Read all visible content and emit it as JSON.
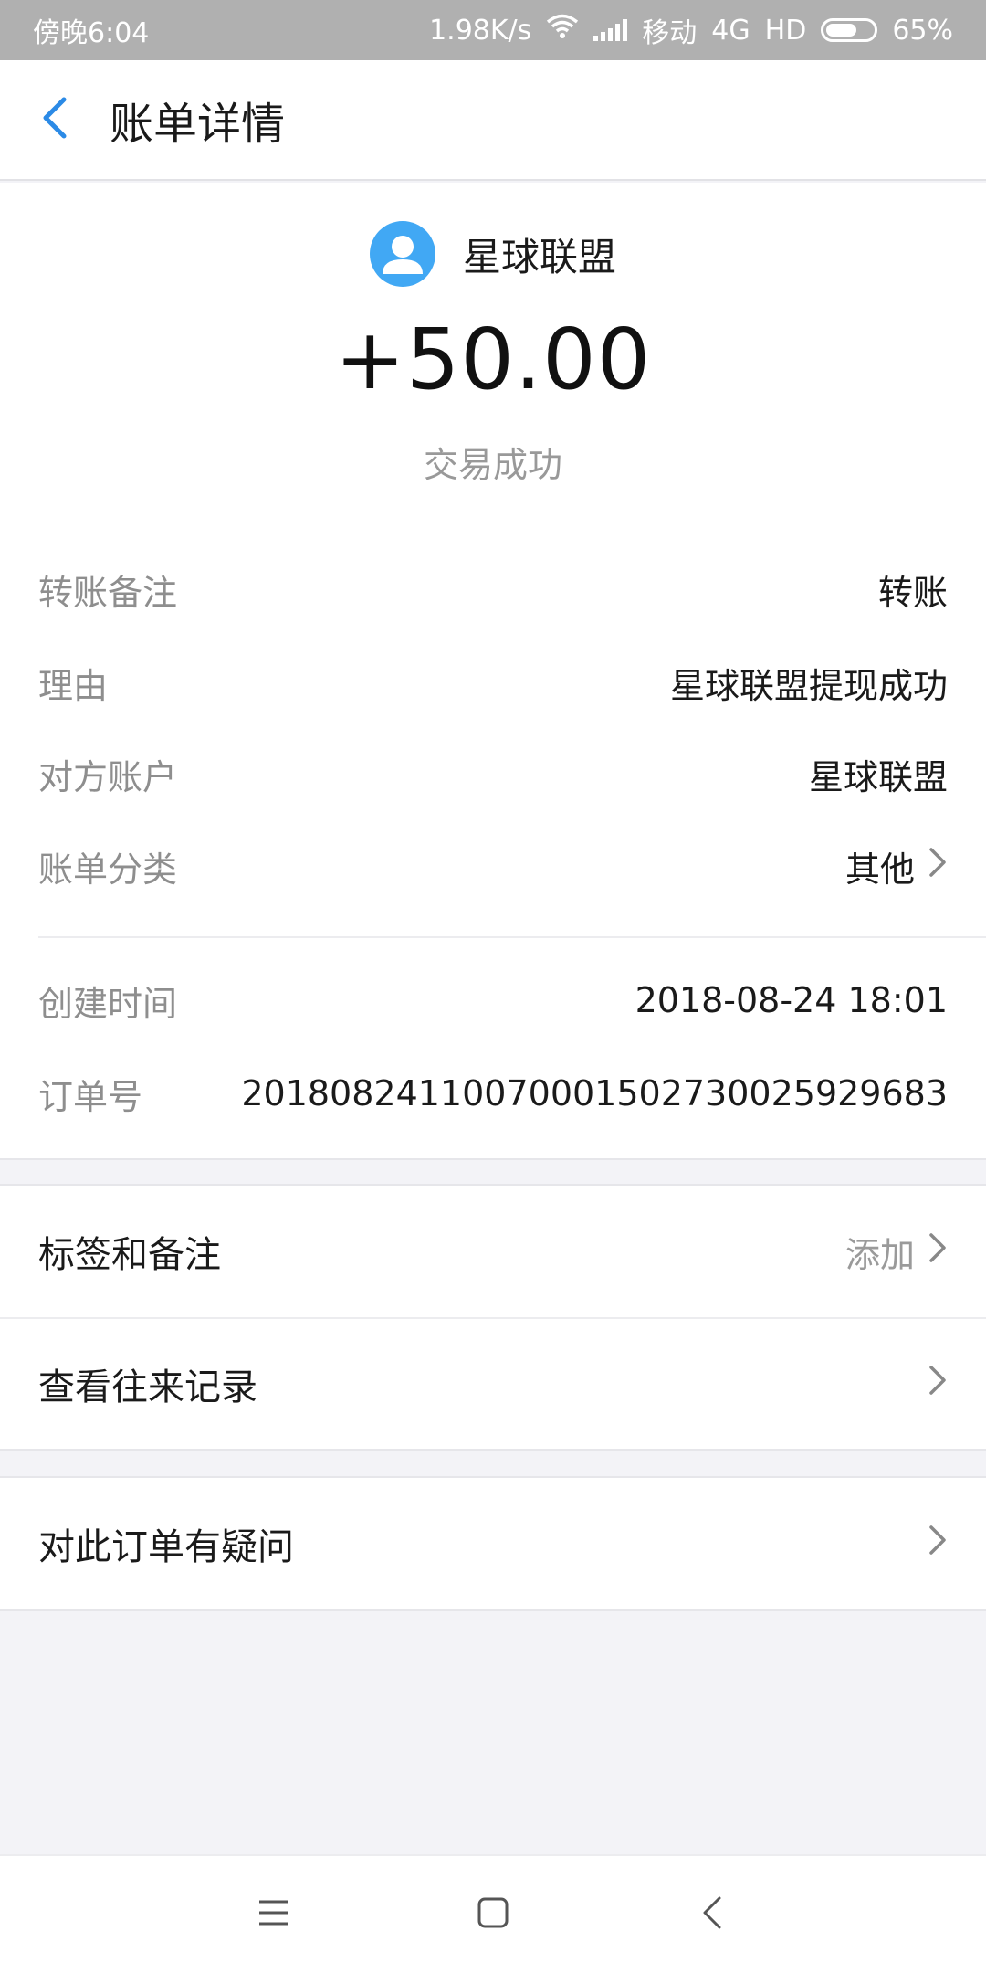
{
  "status_bar": {
    "time": "傍晚6:04",
    "speed": "1.98K/s",
    "carrier": "移动",
    "network": "4G",
    "hd": "HD",
    "battery_percent": "65%",
    "battery_level": 0.65
  },
  "header": {
    "title": "账单详情"
  },
  "summary": {
    "payee_name": "星球联盟",
    "amount": "+50.00",
    "status": "交易成功"
  },
  "details": [
    {
      "label": "转账备注",
      "value": "转账"
    },
    {
      "label": "理由",
      "value": "星球联盟提现成功"
    },
    {
      "label": "对方账户",
      "value": "星球联盟"
    },
    {
      "label": "账单分类",
      "value": "其他"
    },
    {
      "label": "创建时间",
      "value": "2018-08-24 18:01"
    },
    {
      "label": "订单号",
      "value": "20180824110070001502730025929683"
    }
  ],
  "actions": {
    "tags_notes": {
      "label": "标签和备注",
      "hint": "添加"
    },
    "history": {
      "label": "查看往来记录"
    },
    "dispute": {
      "label": "对此订单有疑问"
    }
  },
  "colors": {
    "accent": "#2b8ae6",
    "avatar": "#41a8f4",
    "background": "#f3f3f7"
  },
  "icons": {
    "back": "back-arrow-icon",
    "avatar": "user-avatar-icon",
    "chevron": "chevron-right-icon",
    "nav_menu": "menu-icon",
    "nav_home": "home-square-icon",
    "nav_back": "nav-back-icon"
  }
}
